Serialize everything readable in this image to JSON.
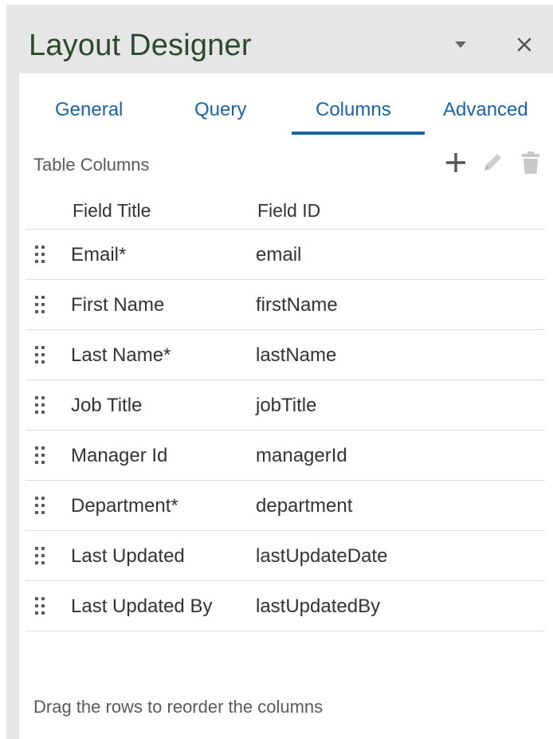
{
  "panel": {
    "title": "Layout Designer",
    "menu_icon": "caret-down-icon",
    "close_icon": "close-icon"
  },
  "tabs": [
    {
      "label": "General",
      "active": false
    },
    {
      "label": "Query",
      "active": false
    },
    {
      "label": "Columns",
      "active": true
    },
    {
      "label": "Advanced",
      "active": false
    }
  ],
  "section": {
    "label": "Table Columns",
    "tools": [
      "plus-icon",
      "pencil-icon",
      "trash-icon"
    ]
  },
  "table": {
    "headers": [
      "Field Title",
      "Field ID"
    ],
    "rows": [
      {
        "title": "Email*",
        "id": "email"
      },
      {
        "title": "First Name",
        "id": "firstName"
      },
      {
        "title": "Last Name*",
        "id": "lastName"
      },
      {
        "title": "Job Title",
        "id": "jobTitle"
      },
      {
        "title": "Manager Id",
        "id": "managerId"
      },
      {
        "title": "Department*",
        "id": "department"
      },
      {
        "title": "Last Updated",
        "id": "lastUpdateDate"
      },
      {
        "title": "Last Updated By",
        "id": "lastUpdatedBy"
      }
    ]
  },
  "footer": {
    "hint": "Drag the rows to reorder the columns"
  },
  "colors": {
    "accent": "#1a63a8",
    "title": "#2b4a2b",
    "panel_bg": "#e6e6e6"
  }
}
